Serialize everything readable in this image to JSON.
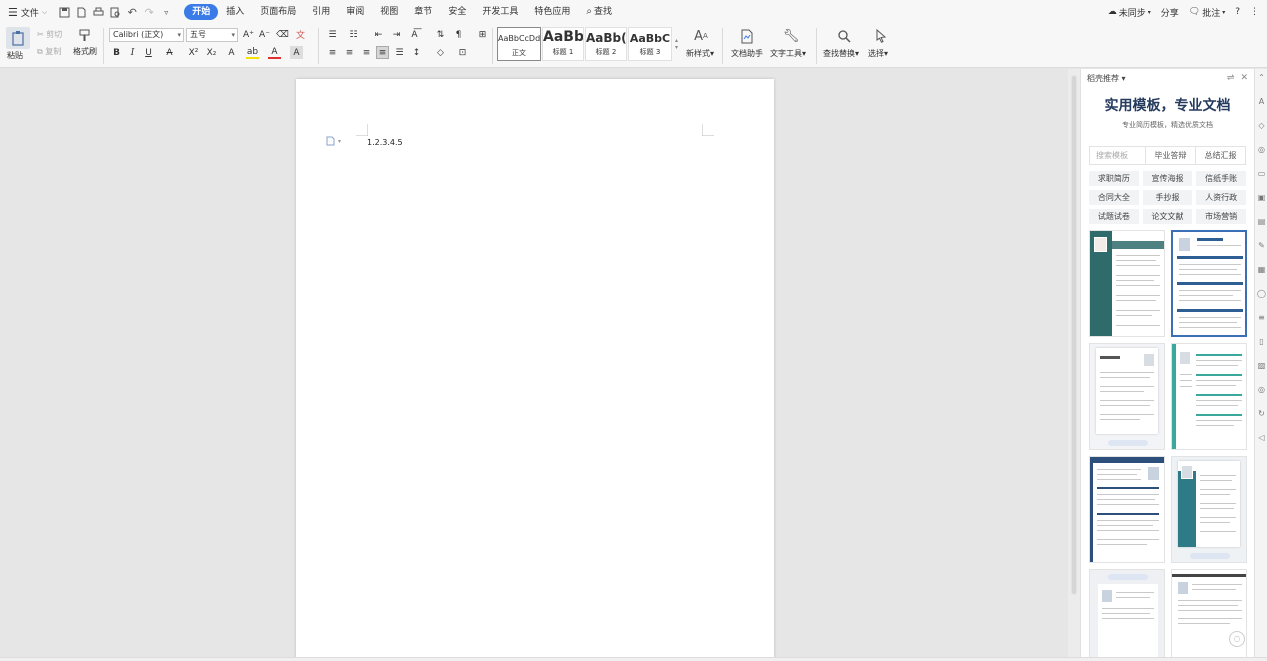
{
  "menubar": {
    "file_label": "文件",
    "tabs": [
      {
        "label": "开始",
        "active": true
      },
      {
        "label": "插入"
      },
      {
        "label": "页面布局"
      },
      {
        "label": "引用"
      },
      {
        "label": "审阅"
      },
      {
        "label": "视图"
      },
      {
        "label": "章节"
      },
      {
        "label": "安全"
      },
      {
        "label": "开发工具"
      },
      {
        "label": "特色应用"
      }
    ],
    "search_label": "查找",
    "sync_label": "未同步",
    "share_label": "分享",
    "comment_label": "批注",
    "help_label": "?"
  },
  "ribbon": {
    "paste_label": "粘贴",
    "cut_label": "剪切",
    "copy_label": "复制",
    "format_painter_label": "格式刷",
    "font_name": "Calibri (正文)",
    "font_size": "五号",
    "grow_font": "A⁺",
    "shrink_font": "A⁻",
    "styles": [
      {
        "sample": "AaBbCcDd",
        "name": "正文"
      },
      {
        "sample": "AaBb",
        "name": "标题 1"
      },
      {
        "sample": "AaBb(",
        "name": "标题 2"
      },
      {
        "sample": "AaBbC",
        "name": "标题 3"
      }
    ],
    "new_style_label": "新样式",
    "doc_assistant_label": "文档助手",
    "text_tools_label": "文字工具",
    "find_replace_label": "查找替换",
    "select_label": "选择"
  },
  "document": {
    "text": "1.2.3.4.5"
  },
  "pane": {
    "header": "稻壳推荐",
    "title": "实用模板，专业文档",
    "subtitle": "专业简历模板，精选优质文档",
    "search_placeholder": "搜索模板",
    "search_tags": [
      "毕业答辩",
      "总结汇报"
    ],
    "categories": [
      "求职简历",
      "宣传海报",
      "信纸手账",
      "合同大全",
      "手抄报",
      "人资行政",
      "试题试卷",
      "论文文献",
      "市场营销"
    ]
  },
  "colors": {
    "accent": "#3b7be8",
    "resume_teal": "#2f6b6b",
    "resume_blue": "#2d5f94",
    "pane_title": "#243a5e"
  }
}
